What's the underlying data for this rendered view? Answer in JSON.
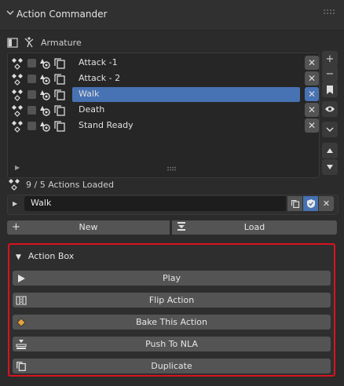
{
  "panel": {
    "title": "Action Commander"
  },
  "armature": {
    "label": "Armature"
  },
  "list": {
    "rows": [
      {
        "name": "Attack -1",
        "selected": false
      },
      {
        "name": "Attack - 2",
        "selected": false
      },
      {
        "name": "Walk",
        "selected": true
      },
      {
        "name": "Death",
        "selected": false
      },
      {
        "name": "Stand Ready",
        "selected": false
      }
    ]
  },
  "status": {
    "text": "9 / 5 Actions Loaded"
  },
  "active_action": {
    "value": "Walk"
  },
  "buttons": {
    "new_label": "New",
    "load_label": "Load"
  },
  "action_box": {
    "title": "Action Box",
    "buttons": [
      {
        "label": "Play",
        "icon": "play-icon"
      },
      {
        "label": "Flip Action",
        "icon": "flip-icon"
      },
      {
        "label": "Bake This Action",
        "icon": "keyframe-icon"
      },
      {
        "label": "Push To NLA",
        "icon": "nla-push-icon"
      },
      {
        "label": "Duplicate",
        "icon": "duplicate-icon"
      }
    ]
  },
  "colors": {
    "selected": "#4772b3",
    "highlight_border": "#d8131f",
    "keyframe": "#e8a23a"
  }
}
